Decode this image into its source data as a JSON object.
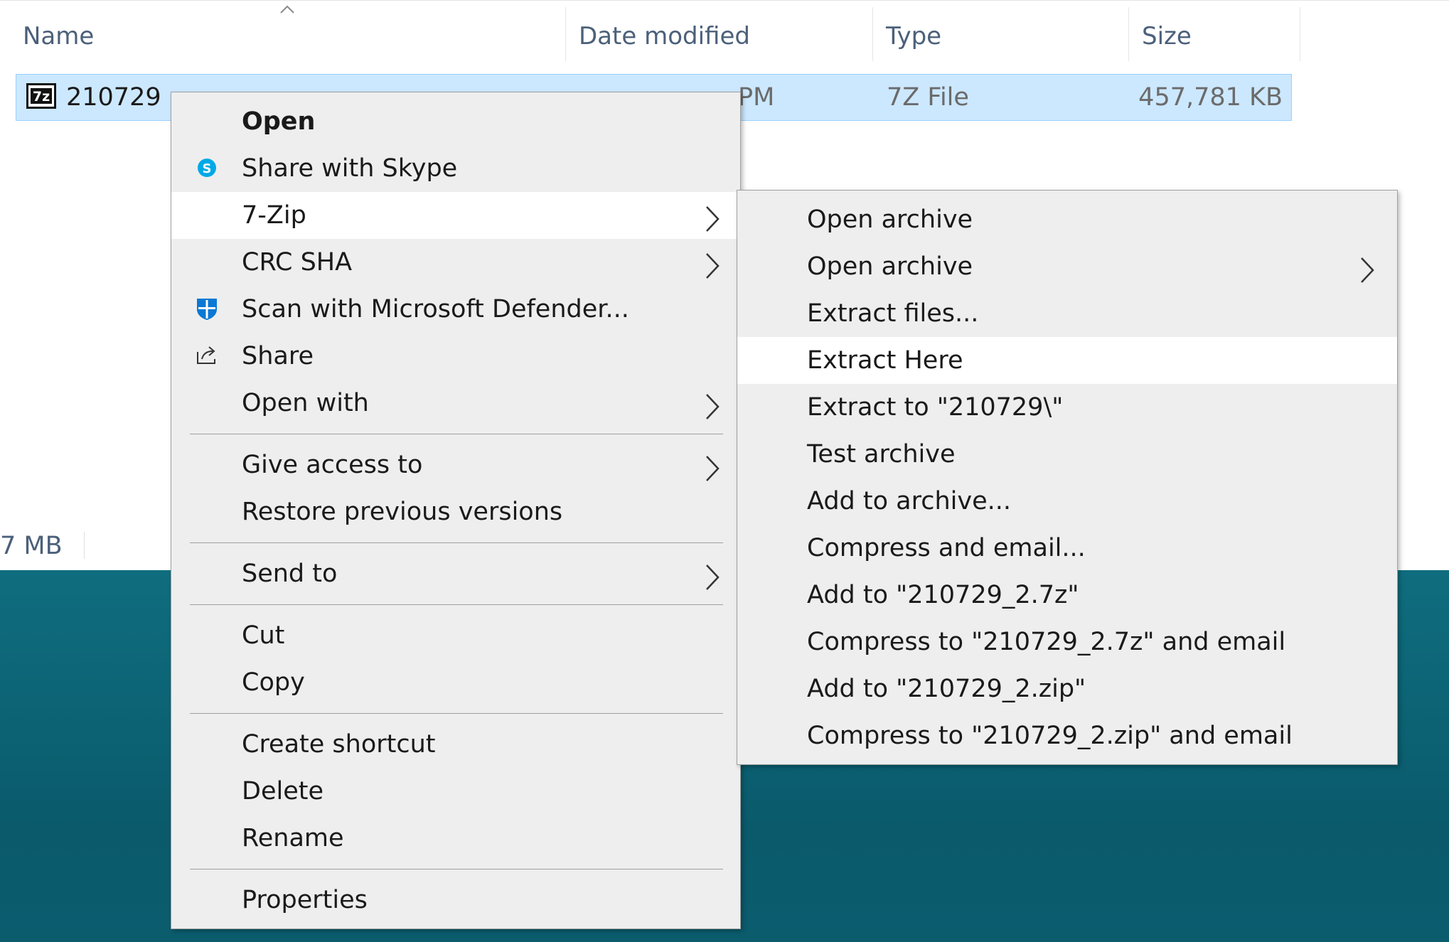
{
  "columns": {
    "name": "Name",
    "date": "Date modified",
    "type": "Type",
    "size": "Size"
  },
  "file": {
    "name": "210729",
    "date_partial": "PM",
    "type": "7Z File",
    "size": "457,781 KB",
    "icon_text": "7z"
  },
  "status_bar": {
    "selected_size": "7 MB"
  },
  "context_menu": [
    {
      "label": "Open",
      "bold": true
    },
    {
      "label": "Share with Skype",
      "icon": "skype-icon"
    },
    {
      "label": "7-Zip",
      "submenu": true,
      "highlighted": true
    },
    {
      "label": "CRC SHA",
      "submenu": true
    },
    {
      "label": "Scan with Microsoft Defender...",
      "icon": "defender-shield-icon"
    },
    {
      "label": "Share",
      "icon": "share-icon"
    },
    {
      "label": "Open with",
      "submenu": true
    },
    {
      "label": "Give access to",
      "submenu": true
    },
    {
      "label": "Restore previous versions"
    },
    {
      "label": "Send to",
      "submenu": true
    },
    {
      "label": "Cut"
    },
    {
      "label": "Copy"
    },
    {
      "label": "Create shortcut"
    },
    {
      "label": "Delete"
    },
    {
      "label": "Rename"
    },
    {
      "label": "Properties"
    }
  ],
  "seven_zip_menu": [
    {
      "label": "Open archive"
    },
    {
      "label": "Open archive",
      "submenu": true
    },
    {
      "label": "Extract files..."
    },
    {
      "label": "Extract Here",
      "highlighted": true
    },
    {
      "label": "Extract to \"210729\\\""
    },
    {
      "label": "Test archive"
    },
    {
      "label": "Add to archive..."
    },
    {
      "label": "Compress and email..."
    },
    {
      "label": "Add to \"210729_2.7z\""
    },
    {
      "label": "Compress to \"210729_2.7z\" and email"
    },
    {
      "label": "Add to \"210729_2.zip\""
    },
    {
      "label": "Compress to \"210729_2.zip\" and email"
    }
  ],
  "colors": {
    "selection": "#cce8ff",
    "selection_border": "#99d1ff",
    "menu_bg": "#eeeeee",
    "menu_highlight": "#ffffff",
    "header_text": "#4c607a",
    "desktop": "#0c6475"
  }
}
